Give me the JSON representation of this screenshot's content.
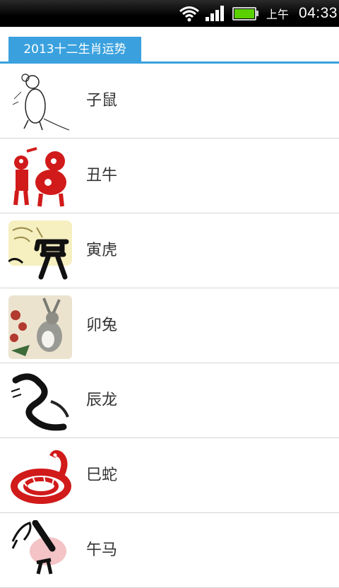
{
  "status_bar": {
    "time": "04:33",
    "am_pm": "上午",
    "icons": [
      "wifi-icon",
      "signal-icon",
      "battery-icon"
    ],
    "battery_level": 1.0
  },
  "tab": {
    "label": "2013十二生肖运势"
  },
  "list": {
    "items": [
      {
        "label": "子鼠",
        "icon": "rat-icon"
      },
      {
        "label": "丑牛",
        "icon": "ox-icon"
      },
      {
        "label": "寅虎",
        "icon": "tiger-icon"
      },
      {
        "label": "卯兔",
        "icon": "rabbit-icon"
      },
      {
        "label": "辰龙",
        "icon": "dragon-icon"
      },
      {
        "label": "巳蛇",
        "icon": "snake-icon"
      },
      {
        "label": "午马",
        "icon": "horse-icon"
      }
    ]
  },
  "colors": {
    "accent": "#3aa1de",
    "paper_cut_red": "#d11a1a",
    "battery_green": "#5ad000"
  }
}
